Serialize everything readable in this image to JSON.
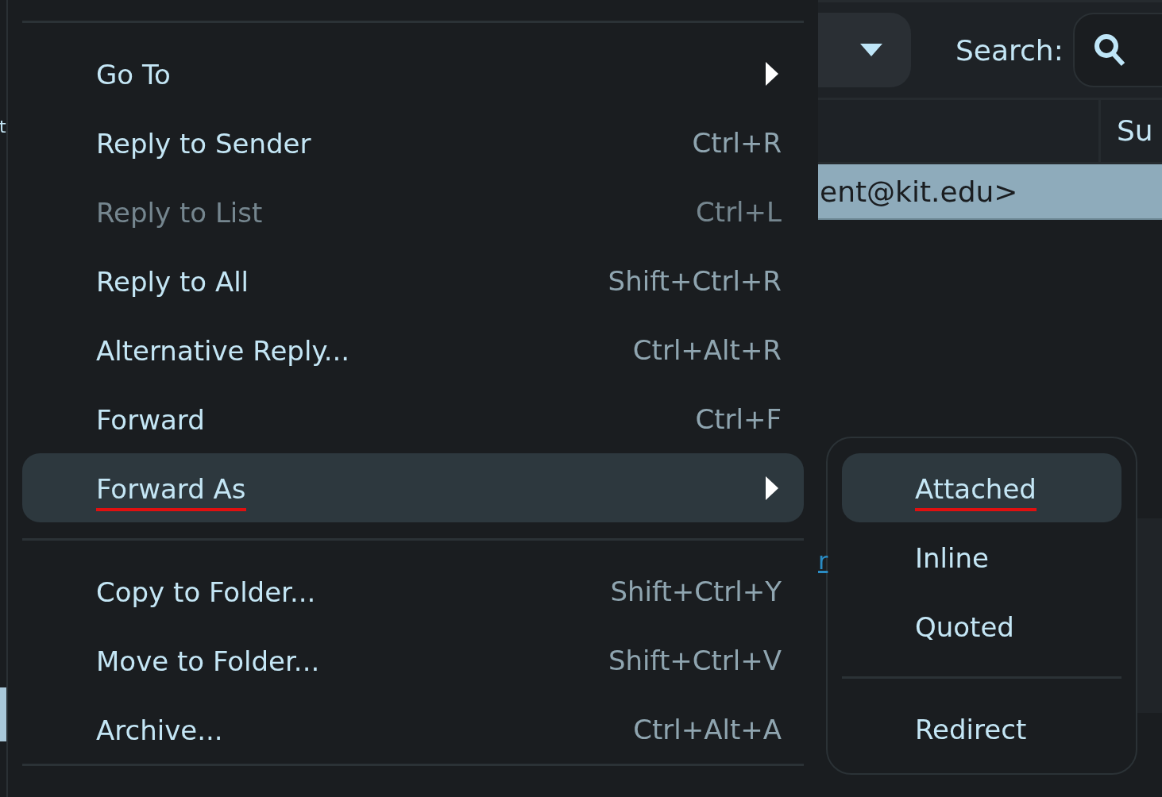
{
  "folder_pane": {
    "fragment": "t"
  },
  "mail_list": {
    "search_label": "Search:",
    "columns": [
      "Su"
    ],
    "selected_row": {
      "sender": "ent@kit.edu>"
    }
  },
  "message_pane": {
    "link_fragment": "r"
  },
  "context_menu": {
    "items": [
      {
        "kind": "separator"
      },
      {
        "kind": "item",
        "label": "Go To",
        "submenu": true,
        "selected": false,
        "disabled": false,
        "marked": false
      },
      {
        "kind": "item",
        "label": "Reply to Sender",
        "shortcut": "Ctrl+R",
        "submenu": false,
        "selected": false,
        "disabled": false,
        "marked": false
      },
      {
        "kind": "item",
        "label": "Reply to List",
        "shortcut": "Ctrl+L",
        "submenu": false,
        "selected": false,
        "disabled": true,
        "marked": false
      },
      {
        "kind": "item",
        "label": "Reply to All",
        "shortcut": "Shift+Ctrl+R",
        "submenu": false,
        "selected": false,
        "disabled": false,
        "marked": false
      },
      {
        "kind": "item",
        "label": "Alternative Reply...",
        "shortcut": "Ctrl+Alt+R",
        "submenu": false,
        "selected": false,
        "disabled": false,
        "marked": false
      },
      {
        "kind": "item",
        "label": "Forward",
        "shortcut": "Ctrl+F",
        "submenu": false,
        "selected": false,
        "disabled": false,
        "marked": false
      },
      {
        "kind": "item",
        "label": "Forward As",
        "submenu": true,
        "selected": true,
        "disabled": false,
        "marked": true
      },
      {
        "kind": "separator"
      },
      {
        "kind": "item",
        "label": "Copy to Folder...",
        "shortcut": "Shift+Ctrl+Y",
        "submenu": false,
        "selected": false,
        "disabled": false,
        "marked": false
      },
      {
        "kind": "item",
        "label": "Move to Folder...",
        "shortcut": "Shift+Ctrl+V",
        "submenu": false,
        "selected": false,
        "disabled": false,
        "marked": false
      },
      {
        "kind": "item",
        "label": "Archive...",
        "shortcut": "Ctrl+Alt+A",
        "submenu": false,
        "selected": false,
        "disabled": false,
        "marked": false
      },
      {
        "kind": "separator"
      }
    ]
  },
  "submenu": {
    "items": [
      {
        "kind": "item",
        "label": "Attached",
        "selected": true,
        "marked": true
      },
      {
        "kind": "item",
        "label": "Inline",
        "selected": false,
        "marked": false
      },
      {
        "kind": "item",
        "label": "Quoted",
        "selected": false,
        "marked": false
      },
      {
        "kind": "separator"
      },
      {
        "kind": "item",
        "label": "Redirect",
        "selected": false,
        "marked": false
      }
    ]
  }
}
